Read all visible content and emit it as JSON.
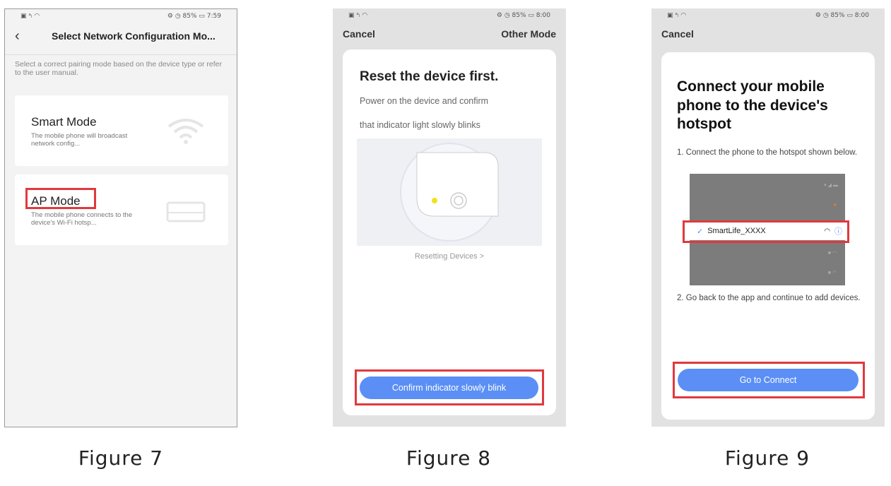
{
  "accent_color": "#5b8ff5",
  "highlight_color": "#e0393e",
  "figure7": {
    "status_left": "▣ ᵃₗ ◠",
    "status_right": "⚙ ◷ 85% ▭ 7:59",
    "title": "Select Network Configuration Mo...",
    "description": "Select a correct pairing mode based on the device type or refer to the user manual.",
    "modes": [
      {
        "name": "Smart Mode",
        "desc": "The mobile phone will broadcast network config...",
        "icon": "wifi-icon"
      },
      {
        "name": "AP Mode",
        "desc": "The mobile phone connects to the device's Wi-Fi hotsp...",
        "icon": "router-icon"
      }
    ],
    "caption": "Figure 7"
  },
  "figure8": {
    "status_left": "▣ ᵃₗ ◠",
    "status_right": "⚙ ◷ 85% ▭ 8:00",
    "cancel": "Cancel",
    "other_mode": "Other Mode",
    "heading": "Reset the device first.",
    "line1": "Power on the device and confirm",
    "line2": "that indicator light slowly blinks",
    "resetting_link": "Resetting Devices  >",
    "confirm_button": "Confirm indicator slowly blink",
    "caption": "Figure 8"
  },
  "figure9": {
    "status_left": "▣ ᵃₗ ◠",
    "status_right": "⚙ ◷ 85% ▭ 8:00",
    "cancel": "Cancel",
    "heading": "Connect your mobile phone to the device's hotspot",
    "step1": "1. Connect the phone to the hotspot shown below.",
    "hotspot_name": "SmartLife_XXXX",
    "step2": "2. Go back to the app and continue to add devices.",
    "connect_button": "Go to Connect",
    "caption": "Figure 9"
  }
}
